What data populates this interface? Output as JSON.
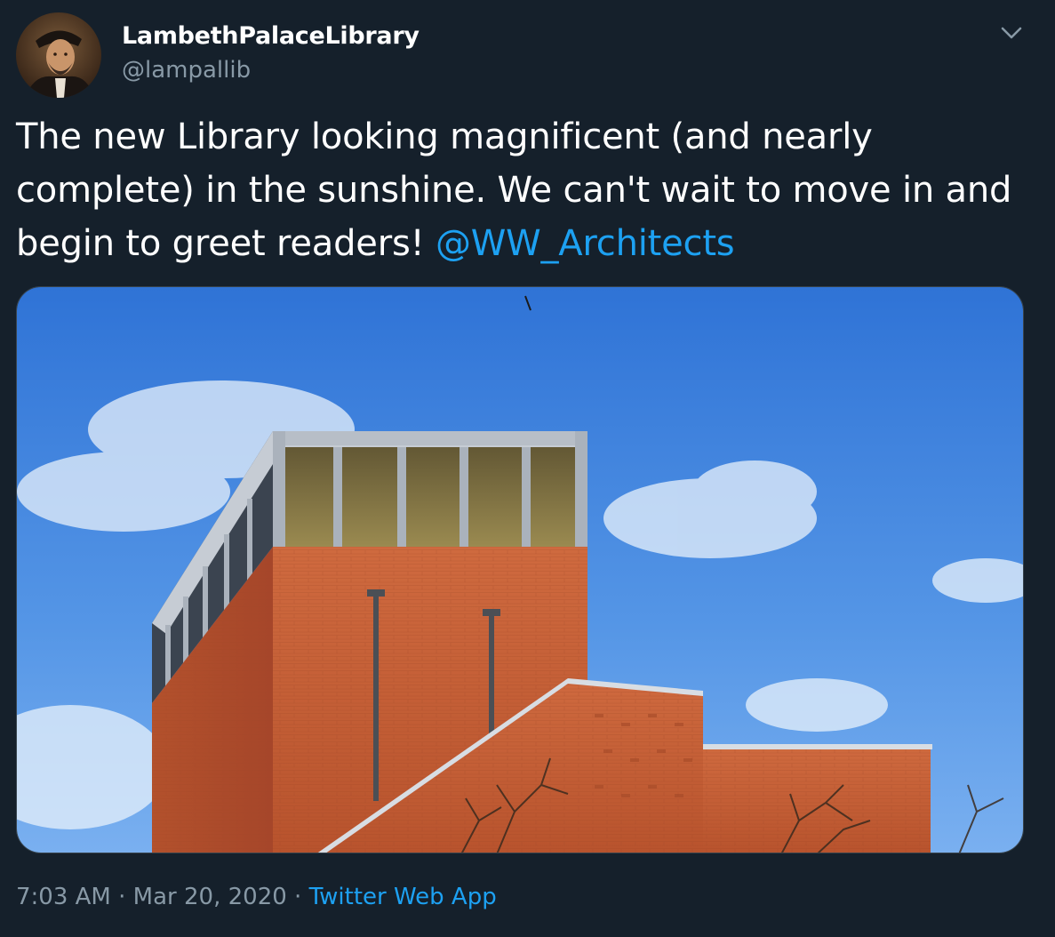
{
  "author": {
    "display_name": "LambethPalaceLibrary",
    "handle": "@lampallib"
  },
  "tweet": {
    "text": "The new Library looking magnificent (and nearly complete) in the sunshine. We can't wait to move in and begin to greet readers! ",
    "mention": "@WW_Architects"
  },
  "meta": {
    "time": "7:03 AM",
    "separator_1": " · ",
    "date": "Mar 20, 2020",
    "separator_2": " · ",
    "source": "Twitter Web App"
  },
  "icons": {
    "more": "chevron-down-icon"
  },
  "colors": {
    "background": "#15202b",
    "secondary_text": "#8899a6",
    "link": "#1da1f2",
    "border": "#38444d"
  }
}
